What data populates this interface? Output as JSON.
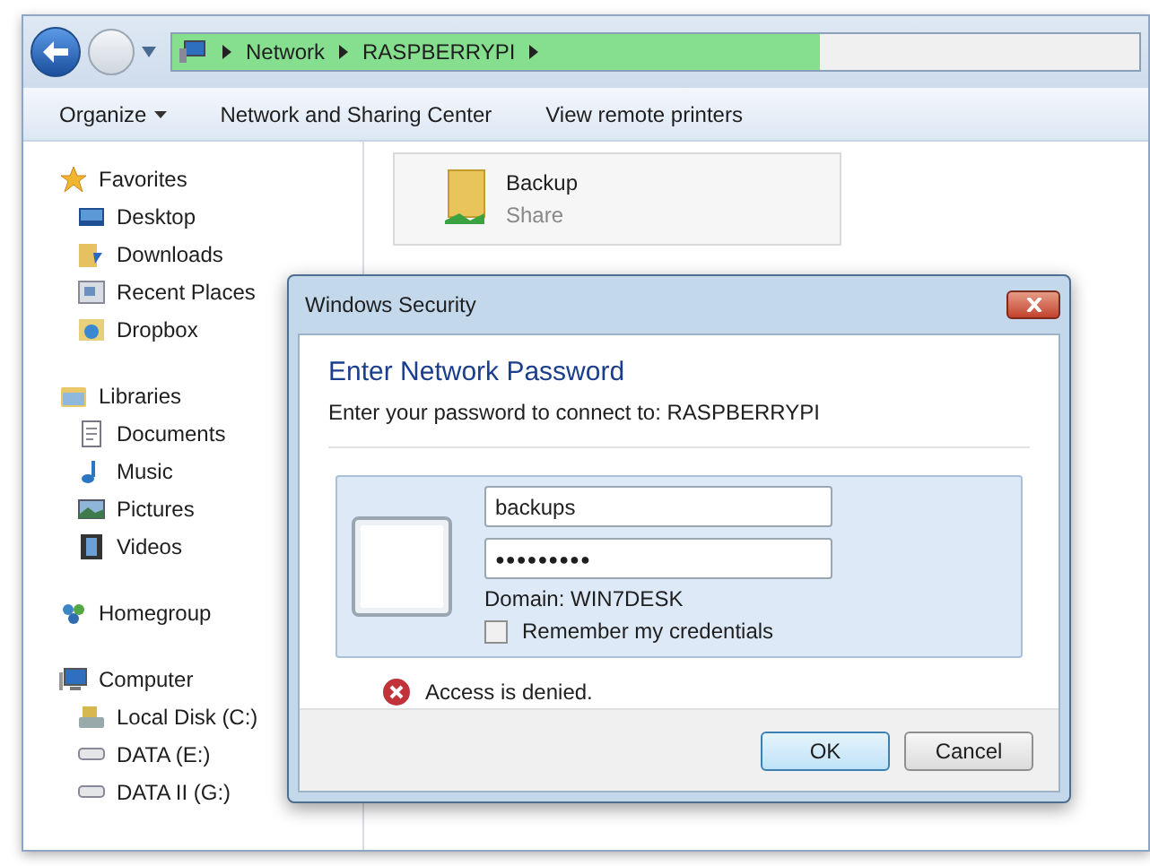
{
  "address_bar": {
    "crumbs": [
      "Network",
      "RASPBERRYPI"
    ],
    "level": 0.67
  },
  "toolbar": {
    "items": [
      {
        "label": "Organize",
        "dropdown": true
      },
      {
        "label": "Network and Sharing Center",
        "dropdown": false
      },
      {
        "label": "View remote printers",
        "dropdown": false
      }
    ]
  },
  "sidebar": {
    "groups": [
      {
        "label": "Favorites",
        "children": [
          {
            "label": "Desktop"
          },
          {
            "label": "Downloads"
          },
          {
            "label": "Recent Places"
          },
          {
            "label": "Dropbox"
          }
        ]
      },
      {
        "label": "Libraries",
        "children": [
          {
            "label": "Documents"
          },
          {
            "label": "Music"
          },
          {
            "label": "Pictures"
          },
          {
            "label": "Videos"
          }
        ]
      },
      {
        "label": "Homegroup"
      },
      {
        "label": "Computer",
        "children": [
          {
            "label": "Local Disk (C:)"
          },
          {
            "label": "DATA (E:)"
          },
          {
            "label": "DATA II (G:)"
          }
        ]
      }
    ]
  },
  "content": {
    "items": [
      {
        "name": "Backup",
        "type": "Share"
      }
    ]
  },
  "dialog": {
    "title": "Windows Security",
    "heading": "Enter Network Password",
    "subtitle": "Enter your password to connect to: RASPBERRYPI",
    "username": "backups",
    "password": "●●●●●●●●●",
    "domain": "Domain: WIN7DESK",
    "remember": {
      "label": "Remember my credentials",
      "checked": false
    },
    "error": "Access is denied.",
    "buttons": [
      {
        "label": "OK",
        "default": true
      },
      {
        "label": "Cancel",
        "default": false
      }
    ]
  }
}
